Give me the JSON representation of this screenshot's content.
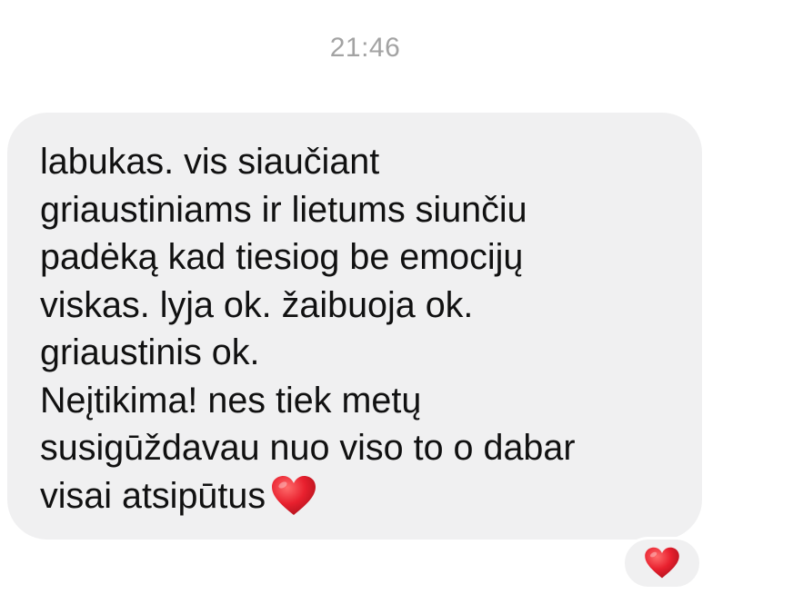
{
  "conversation": {
    "timestamp": "21:46",
    "message": {
      "text": "labukas. vis siaučiant\ngriaustiniams ir lietums siunčiu\npadėką kad tiesiog be emocijų\nviskas. lyja ok. žaibuoja ok.\ngriaustinis ok.\nNeįtikima! nes tiek metų\nsusigūždavau nuo viso to o dabar\nvisai atsipūtus",
      "trailing_emoji": "red-heart-icon"
    },
    "reaction": {
      "emoji": "red-heart-icon"
    }
  },
  "colors": {
    "bubble_background": "#f0f0f1",
    "text": "#111111",
    "timestamp": "#a3a3a3",
    "heart": "#e8202e"
  }
}
